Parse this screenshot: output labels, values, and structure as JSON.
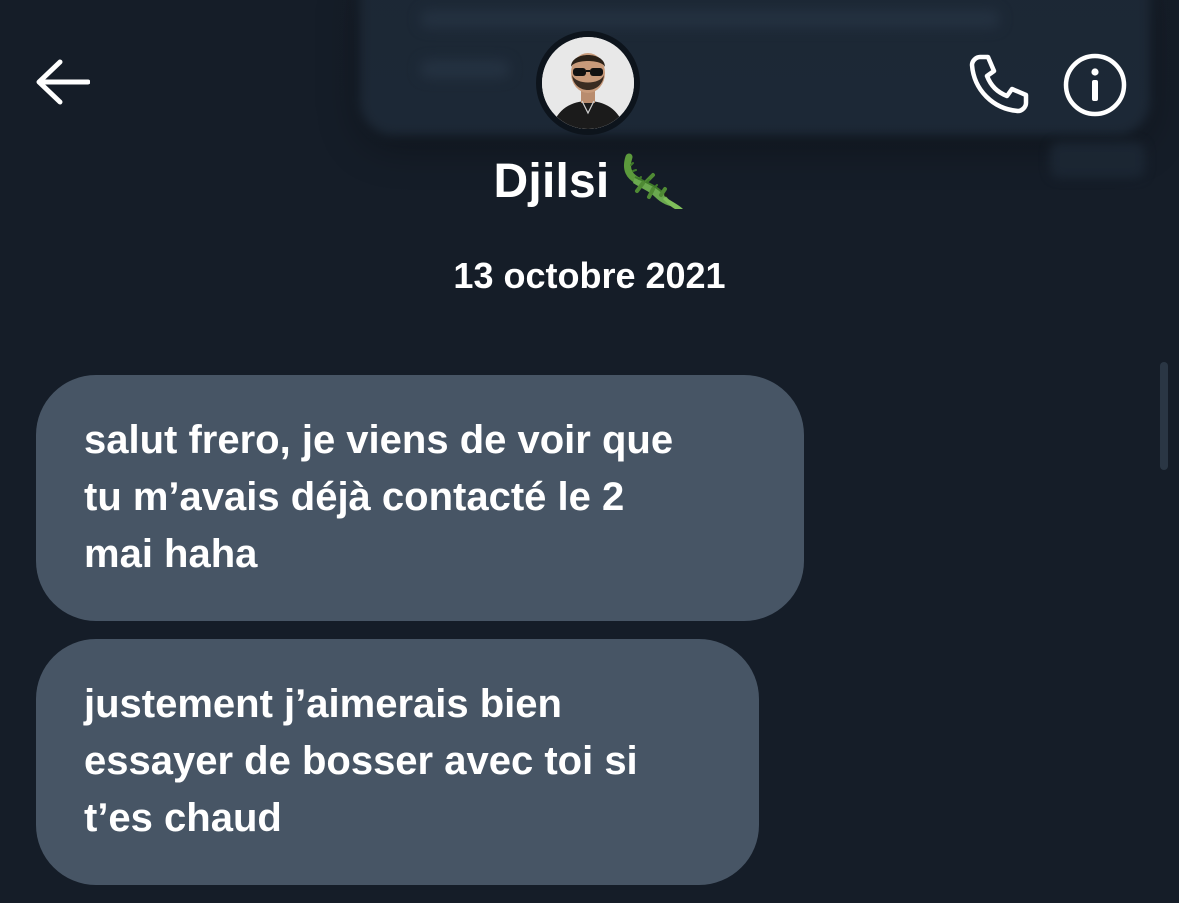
{
  "header": {
    "back_icon": "arrow-left-icon",
    "avatar_icon": "profile-photo",
    "call_icon": "phone-icon",
    "info_icon": "info-icon",
    "contact_name": "Djilsi",
    "contact_emoji": "🐊"
  },
  "conversation": {
    "date": "13 octobre 2021",
    "messages": [
      {
        "lines": [
          "salut frero, je viens de voir que",
          "tu m’avais déjà contacté le 2",
          "mai haha"
        ]
      },
      {
        "lines": [
          "justement j’aimerais bien",
          "essayer de bosser avec toi si",
          "t’es chaud"
        ]
      }
    ]
  },
  "colors": {
    "background": "#151d28",
    "bubble": "#475565",
    "text": "#ffffff"
  }
}
